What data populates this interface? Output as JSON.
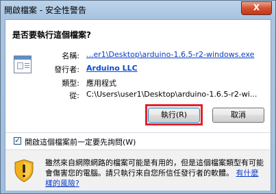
{
  "window": {
    "title": "開啟檔案 - 安全性警告",
    "close_glyph": "X"
  },
  "question": "是否要執行這個檔案?",
  "file_icon": "executable-file-icon",
  "details": {
    "name_label": "名稱:",
    "name_value": "...er1\\Desktop\\arduino-1.6.5-r2-windows.exe",
    "publisher_label": "發行者:",
    "publisher_value": "Arduino LLC",
    "type_label": "類型:",
    "type_value": "應用程式",
    "from_label": "從:",
    "from_value": "C:\\Users\\user1\\Desktop\\arduino-1.6.5-r2-wi..."
  },
  "buttons": {
    "run": "執行(R)",
    "cancel": "取消"
  },
  "checkbox": {
    "label": "開啟這個檔案前一定要先詢問(W)",
    "checked": true,
    "glyph": "✓"
  },
  "warning": {
    "icon": "shield-warning-icon",
    "text": "雖然來自網際網路的檔案可能是有用的，但是這個檔案類型有可能會傷害您的電腦。請只執行來自您所信任發行者的軟體。",
    "link": "有什麼樣的風險?"
  },
  "colors": {
    "link": "#0a3cc6",
    "highlight": "#e3202b",
    "titlebar": "#bcd4ea"
  }
}
